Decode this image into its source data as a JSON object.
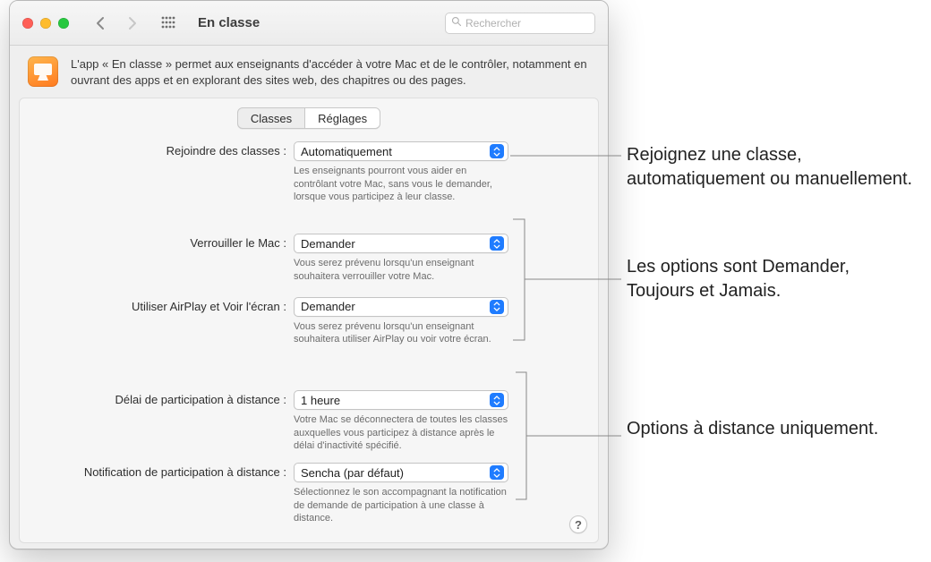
{
  "window": {
    "title": "En classe",
    "search_placeholder": "Rechercher",
    "description": "L'app « En classe » permet aux enseignants d'accéder à votre Mac et de le contrôler, notamment en ouvrant des apps et en explorant des sites web, des chapitres ou des pages."
  },
  "tabs": {
    "classes": "Classes",
    "settings": "Réglages"
  },
  "rows": {
    "join": {
      "label": "Rejoindre des classes :",
      "value": "Automatiquement",
      "desc": "Les enseignants pourront vous aider en contrôlant votre Mac, sans vous le demander, lorsque vous participez à leur classe."
    },
    "lock": {
      "label": "Verrouiller le Mac :",
      "value": "Demander",
      "desc": "Vous serez prévenu lorsqu'un enseignant souhaitera verrouiller votre Mac."
    },
    "airplay": {
      "label": "Utiliser AirPlay et Voir l'écran :",
      "value": "Demander",
      "desc": "Vous serez prévenu lorsqu'un enseignant souhaitera utiliser AirPlay ou voir votre écran."
    },
    "timeout": {
      "label": "Délai de participation à distance :",
      "value": "1 heure",
      "desc": "Votre Mac se déconnectera de toutes les classes auxquelles vous participez à distance après le délai d'inactivité spécifié."
    },
    "sound": {
      "label": "Notification de participation à distance :",
      "value": "Sencha (par défaut)",
      "desc": "Sélectionnez le son accompagnant la notification de demande de participation à une classe à distance."
    }
  },
  "help": "?",
  "callouts": {
    "c1": "Rejoignez une classe, automatiquement ou manuellement.",
    "c2": "Les options sont Demander, Toujours et Jamais.",
    "c3": "Options à distance uniquement."
  }
}
